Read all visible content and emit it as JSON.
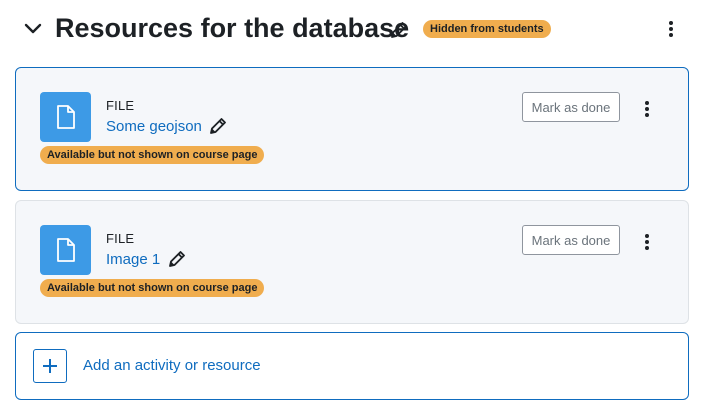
{
  "section": {
    "title": "Resources for the database",
    "visibility_badge": "Hidden from students"
  },
  "activities": [
    {
      "type": "FILE",
      "name": "Some geojson",
      "availability_badge": "Available but not shown on course page",
      "completion_button": "Mark as done"
    },
    {
      "type": "FILE",
      "name": "Image 1",
      "availability_badge": "Available but not shown on course page",
      "completion_button": "Mark as done"
    }
  ],
  "add_activity": {
    "label": "Add an activity or resource"
  },
  "icons": {
    "collapse": "chevron-down-icon",
    "edit": "pencil-icon",
    "menu": "kebab-menu-icon",
    "file": "file-icon",
    "add": "plus-icon"
  },
  "colors": {
    "link": "#0f6cbf",
    "badge_warning": "#f0ad4e",
    "file_icon_bg": "#3d9ae6",
    "card_bg": "#f5f7fa"
  }
}
